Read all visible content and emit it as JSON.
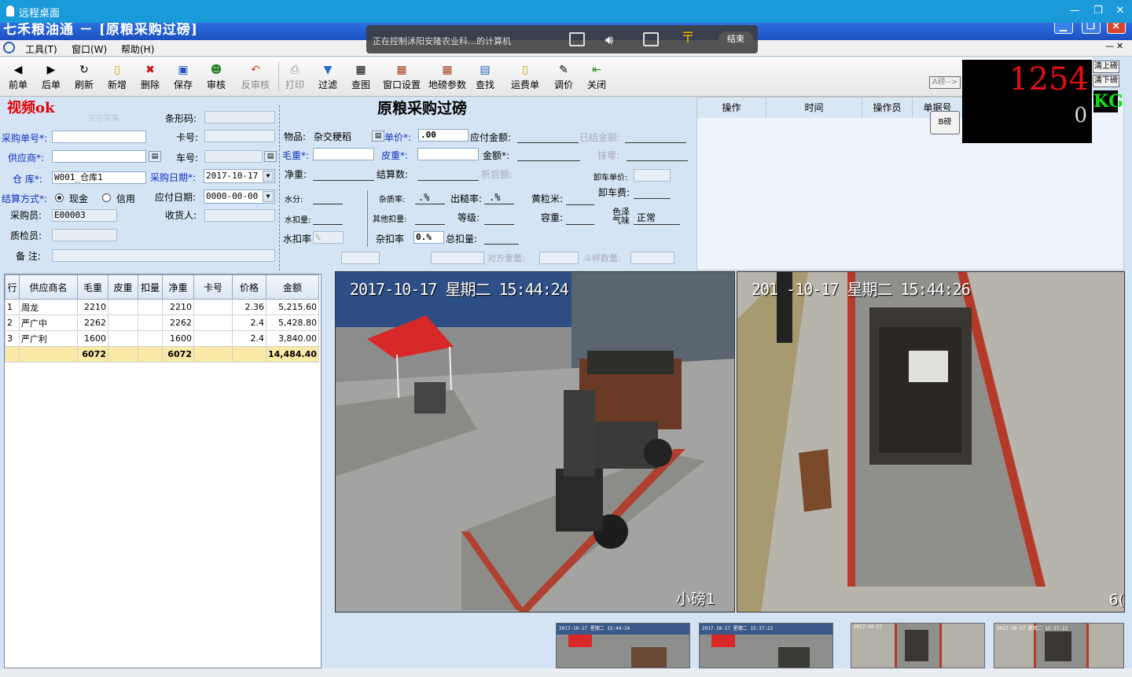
{
  "remote_desktop": {
    "title": "远程桌面",
    "min": "—",
    "max": "❐",
    "close": "✕"
  },
  "app": {
    "title": "七禾粮油通 － [原粮采购过磅]"
  },
  "menu": [
    "工具(T)",
    "窗口(W)",
    "帮助(H)"
  ],
  "remote_overlay": {
    "message": "正在控制沭阳安隆农业科…的计算机",
    "end": "结束"
  },
  "toolbar": [
    {
      "label": "前单",
      "icon": "◀"
    },
    {
      "label": "后单",
      "icon": "▶"
    },
    {
      "label": "刷新",
      "icon": "↻"
    },
    {
      "label": "新增",
      "icon": "▯"
    },
    {
      "label": "删除",
      "icon": "✖"
    },
    {
      "label": "保存",
      "icon": "▣"
    },
    {
      "label": "审核",
      "icon": "☻"
    },
    {
      "label": "反审核",
      "icon": "↶"
    },
    {
      "label": "打印",
      "icon": "⎙"
    },
    {
      "label": "过滤",
      "icon": "▼"
    },
    {
      "label": "查图",
      "icon": "▦"
    },
    {
      "label": "窗口设置",
      "icon": "▦"
    },
    {
      "label": "地磅参数",
      "icon": "▦"
    },
    {
      "label": "查找",
      "icon": "▤"
    },
    {
      "label": "运费单",
      "icon": "▯"
    },
    {
      "label": "调价",
      "icon": "✎"
    },
    {
      "label": "关闭",
      "icon": "⇤"
    }
  ],
  "header": {
    "video_status": "视频ok",
    "title": "原粮采购过磅",
    "faint_note": "正在采集"
  },
  "form": {
    "barcode_label": "条形码:",
    "card_label": "卡号:",
    "car_label": "车号:",
    "purchase_no_label": "采购单号*:",
    "supplier_label": "供应商*:",
    "warehouse_label": "仓  库*:",
    "warehouse_value": "W001_仓库1",
    "purchase_date_label": "采购日期*:",
    "purchase_date_value": "2017-10-17",
    "settle_label": "结算方式*:",
    "settle_cash": "现金",
    "settle_credit": "信用",
    "due_date_label": "应付日期:",
    "due_date_value": "0000-00-00",
    "buyer_label": "采购员:",
    "buyer_value": "E00003",
    "receiver_label": "收货人:",
    "inspector_label": "质检员:",
    "remark_label": "备  注:",
    "item_label": "物品:",
    "item_value": "杂交粳稻",
    "price_label": "单价*:",
    "price_value": ".00",
    "payable_label": "应付金额:",
    "settled_label": "已结金额:",
    "gross_label": "毛重*:",
    "tare_label": "皮重*:",
    "amount_label": "金额*:",
    "wipe_label": "抹零:",
    "net_label": "净重:",
    "settle_qty_label": "结算数:",
    "discount_label": "折后额:",
    "unload_price_label": "卸车单价:",
    "moisture_label": "水分:",
    "impurity_label": "杂质率:",
    "impurity_value": ".%",
    "polish_label": "出糙率:",
    "polish_value": ".%",
    "yellow_label": "黄粒米:",
    "unload_fee_label": "卸车费:",
    "water_deduct_label": "水扣量:",
    "other_deduct_label": "其他扣量:",
    "grade_label": "等级:",
    "bulk_label": "容重:",
    "color_label": "色泽\n气味",
    "color_value": "正常",
    "water_rate_label": "水扣率",
    "water_rate_value": "%",
    "impurity_rate_label": "杂扣率",
    "impurity_rate_value": "0.%",
    "total_deduct_label": "总扣量:",
    "other_weight_label": "对方重量:",
    "bucket_label": "斗秤数量:"
  },
  "log": {
    "columns": [
      "操作",
      "时间",
      "操作员",
      "单据号"
    ]
  },
  "scale": {
    "weight": "1254",
    "weight2": "0",
    "unit": "KG",
    "a_btn": "A磅-->",
    "b_btn": "B磅",
    "prev_btn": "清上磅",
    "next_btn": "清下磅"
  },
  "grid": {
    "columns": [
      "行",
      "供应商名",
      "毛重",
      "皮重",
      "扣量",
      "净重",
      "卡号",
      "价格",
      "金额"
    ],
    "rows": [
      [
        "1",
        "周龙",
        "2210",
        "",
        "",
        "2210",
        "",
        "2.36",
        "5,215.60"
      ],
      [
        "2",
        "严广中",
        "2262",
        "",
        "",
        "2262",
        "",
        "2.4",
        "5,428.80"
      ],
      [
        "3",
        "严广利",
        "1600",
        "",
        "",
        "1600",
        "",
        "2.4",
        "3,840.00"
      ]
    ],
    "total": [
      "",
      "",
      "6072",
      "",
      "",
      "6072",
      "",
      "",
      "14,484.40"
    ]
  },
  "cameras": [
    {
      "timestamp": "2017-10-17 星期二 15:44:24",
      "label": "小磅1"
    },
    {
      "timestamp": "201 -10-17 星期二 15:44:26",
      "label": "6("
    }
  ],
  "thumbs": [
    "2017-10-17 星期二 15:44:24",
    "2017-10-17 星期二 15:37:22",
    "2017-10-17",
    "2017-10-17 星期二 15:37:22"
  ]
}
